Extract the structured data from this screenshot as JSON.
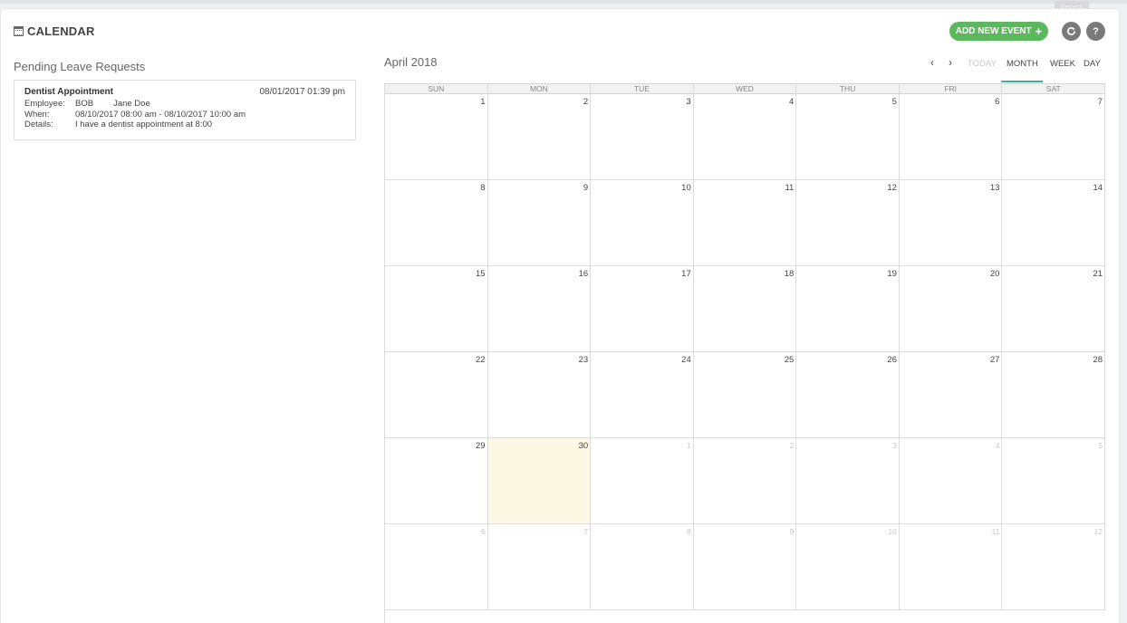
{
  "header": {
    "title": "CALENDAR",
    "add_button": "ADD NEW EVENT",
    "add_plus": "+",
    "refresh_tooltip": "Refresh",
    "help_label": "?"
  },
  "pending": {
    "title": "Pending Leave Requests",
    "requests": [
      {
        "name": "Dentist Appointment",
        "date": "08/01/2017 01:39 pm",
        "employee_label": "Employee:",
        "employee_id": "BOB",
        "employee_name": "Jane Doe",
        "when_label": "When:",
        "when": "08/10/2017 08:00 am - 08/10/2017 10:00 am",
        "details_label": "Details:",
        "details": "I have a dentist appointment at 8:00"
      }
    ]
  },
  "calendar": {
    "month_title": "April 2018",
    "nav": {
      "prev": "‹",
      "next": "›",
      "today": "TODAY",
      "month": "MONTH",
      "week": "WEEK",
      "day": "DAY"
    },
    "active_view": "MONTH",
    "weekdays": [
      "SUN",
      "MON",
      "TUE",
      "WED",
      "THU",
      "FRI",
      "SAT"
    ],
    "weeks": [
      [
        "1",
        "2",
        "3",
        "4",
        "5",
        "6",
        "7"
      ],
      [
        "8",
        "9",
        "10",
        "11",
        "12",
        "13",
        "14"
      ],
      [
        "15",
        "16",
        "17",
        "18",
        "19",
        "20",
        "21"
      ],
      [
        "22",
        "23",
        "24",
        "25",
        "26",
        "27",
        "28"
      ],
      [
        "29",
        "30",
        "1",
        "2",
        "3",
        "4",
        "5"
      ],
      [
        "6",
        "7",
        "8",
        "9",
        "10",
        "11",
        "12"
      ]
    ],
    "today_cell": {
      "week": 4,
      "day": 1
    },
    "colors": {
      "accent": "#3eaf9b",
      "add_button": "#5cb85c",
      "today_bg": "#fcf8e3"
    }
  }
}
